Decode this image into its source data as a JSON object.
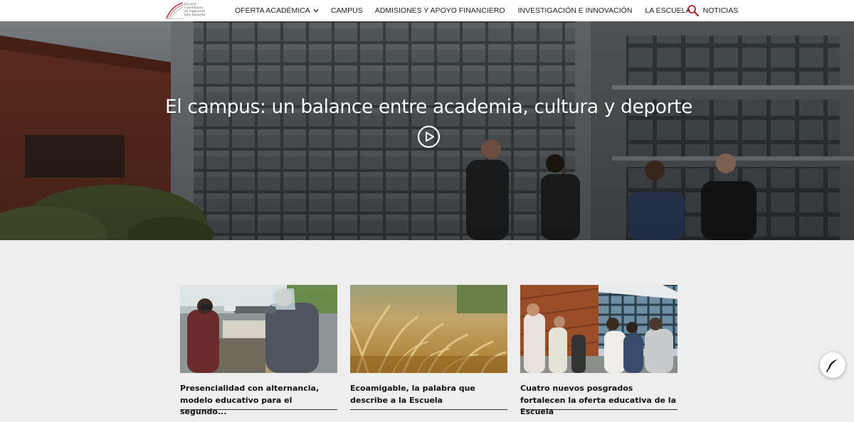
{
  "header": {
    "logo_lines": [
      "Escuela",
      "Colombiana",
      "de Ingeniería",
      "Julio Garavito"
    ],
    "nav": [
      {
        "label": "OFERTA ACADÉMICA",
        "dropdown": true
      },
      {
        "label": "CAMPUS"
      },
      {
        "label": "ADMISIONES Y APOYO FINANCIERO"
      },
      {
        "label": "INVESTIGACIÓN E INNOVACIÓN"
      },
      {
        "label": "LA ESCUELA"
      },
      {
        "label": "NOTICIAS"
      }
    ],
    "search_icon": "search-icon",
    "accent": "#b0242a"
  },
  "hero": {
    "title": "El campus: un balance entre academia, cultura y deporte",
    "play_icon": "play-circle-icon"
  },
  "cards": [
    {
      "caption": "Presencialidad con alternancia, modelo educativo para el segundo..."
    },
    {
      "caption": "Ecoamigable, la palabra que describe a la Escuela"
    },
    {
      "caption": "Cuatro nuevos posgrados fortalecen la oferta educativa de la Escuela"
    }
  ],
  "floating_button": {
    "icon": "feather-pen-icon"
  }
}
